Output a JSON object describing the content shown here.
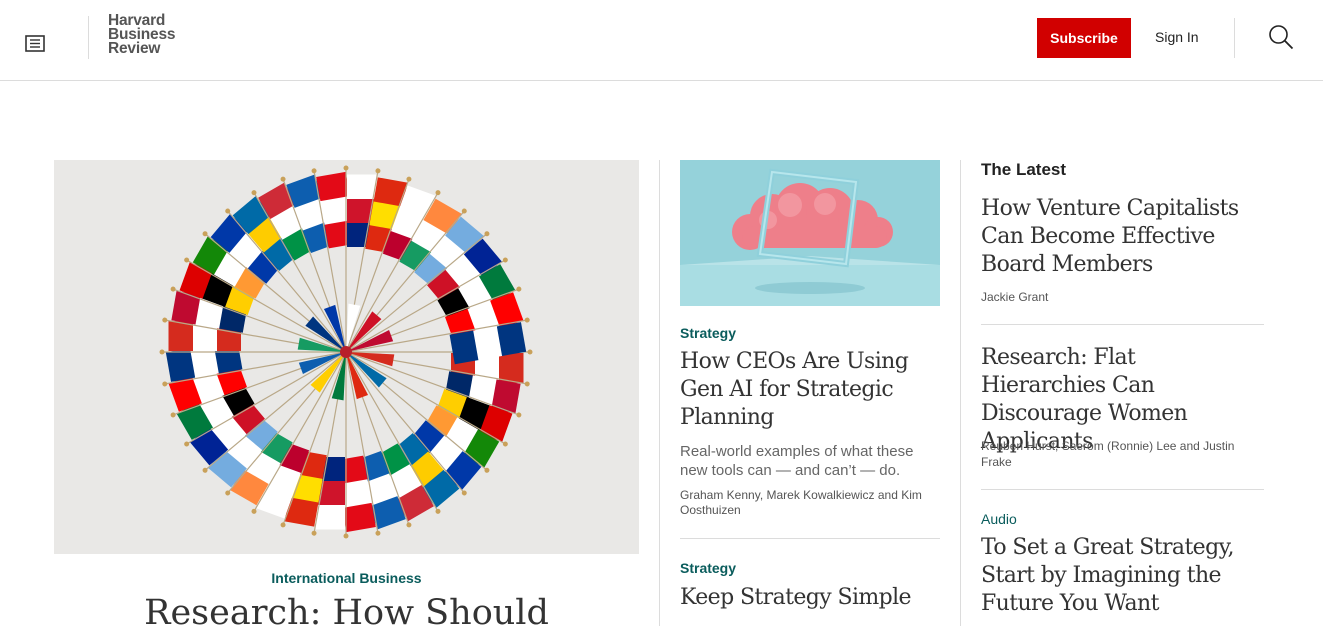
{
  "header": {
    "logo_lines": [
      "Harvard",
      "Business",
      "Review"
    ],
    "subscribe_label": "Subscribe",
    "signin_label": "Sign In"
  },
  "hero": {
    "topic": "International Business",
    "title": "Research: How Should"
  },
  "middle": {
    "articles": [
      {
        "topic": "Strategy",
        "title": "How CEOs Are Using Gen AI for Strategic Planning",
        "description": "Real-world examples of what these new tools can — and can’t — do.",
        "authors": "Graham Kenny, Marek Kowalkiewicz and Kim Oosthuizen"
      },
      {
        "topic": "Strategy",
        "title": "Keep Strategy Simple"
      }
    ]
  },
  "latest": {
    "heading": "The Latest",
    "items": [
      {
        "title": "How Venture Capitalists Can Become Effective Board Members",
        "authors": "Jackie Grant"
      },
      {
        "title": "Research: Flat Hierarchies Can Discourage Women Applicants",
        "authors": "Reuben Hurst, Saerom (Ronnie) Lee and Justin Frake"
      },
      {
        "topic": "Audio",
        "title": "To Set a Great Strategy, Start by Imagining the Future You Want"
      }
    ]
  },
  "colors": {
    "brand_red": "#d10000",
    "topic_teal": "#0a5c5c"
  },
  "icons": [
    "menu-icon",
    "search-icon"
  ]
}
